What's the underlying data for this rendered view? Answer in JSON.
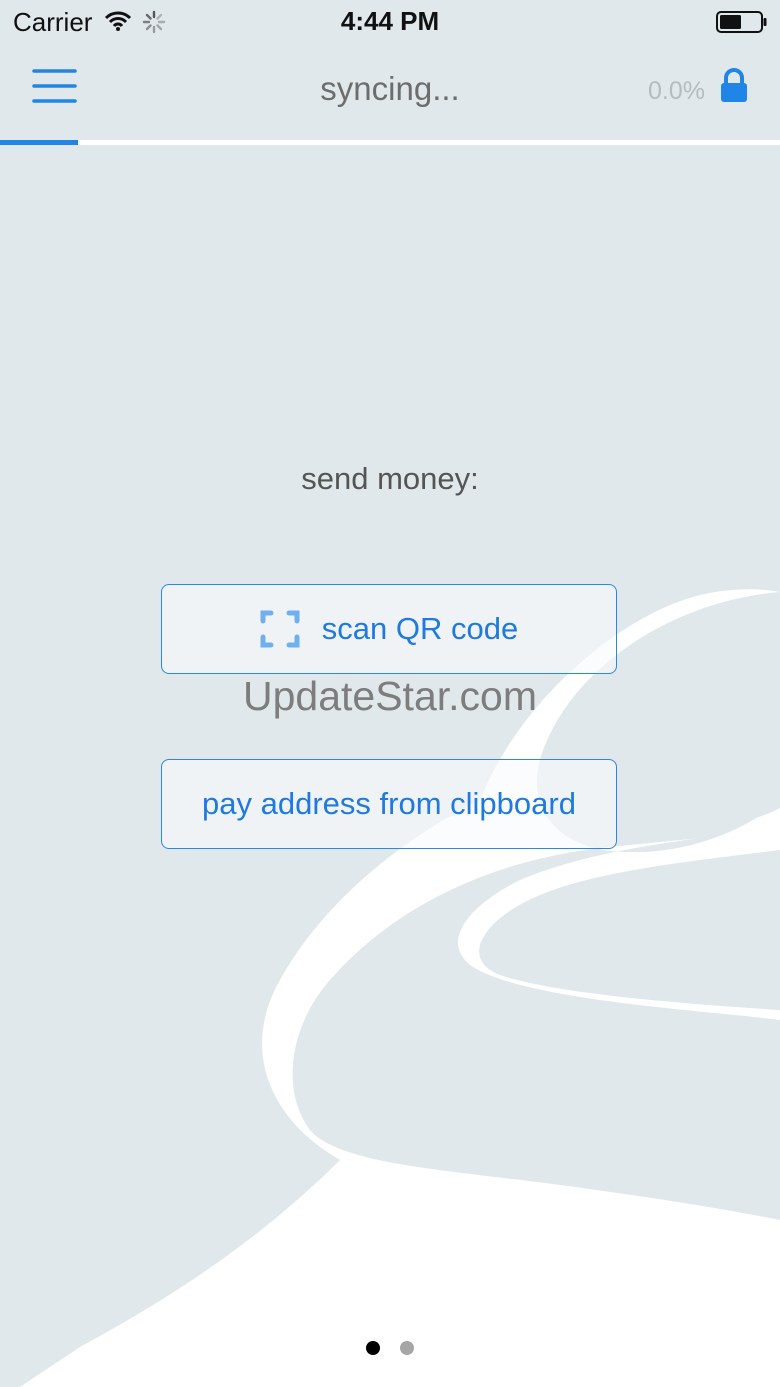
{
  "status_bar": {
    "carrier": "Carrier",
    "time": "4:44 PM",
    "icons": [
      "wifi-icon",
      "activity-spinner-icon",
      "battery-icon"
    ]
  },
  "nav": {
    "menu_icon": "hamburger-menu-icon",
    "title": "syncing...",
    "progress_text": "0.0%",
    "lock_icon": "lock-icon",
    "sync_progress_fraction": 0.1
  },
  "main": {
    "send_label": "send money:",
    "scan_button": {
      "icon": "qr-scan-icon",
      "label": "scan QR code"
    },
    "clipboard_button": {
      "label": "pay address from clipboard"
    },
    "watermark": "UpdateStar.com"
  },
  "pager": {
    "current_page": 1,
    "page_count": 2
  },
  "colors": {
    "accent": "#1f86e8",
    "background": "#e0e8eb",
    "button_text": "#1f7ae0"
  }
}
